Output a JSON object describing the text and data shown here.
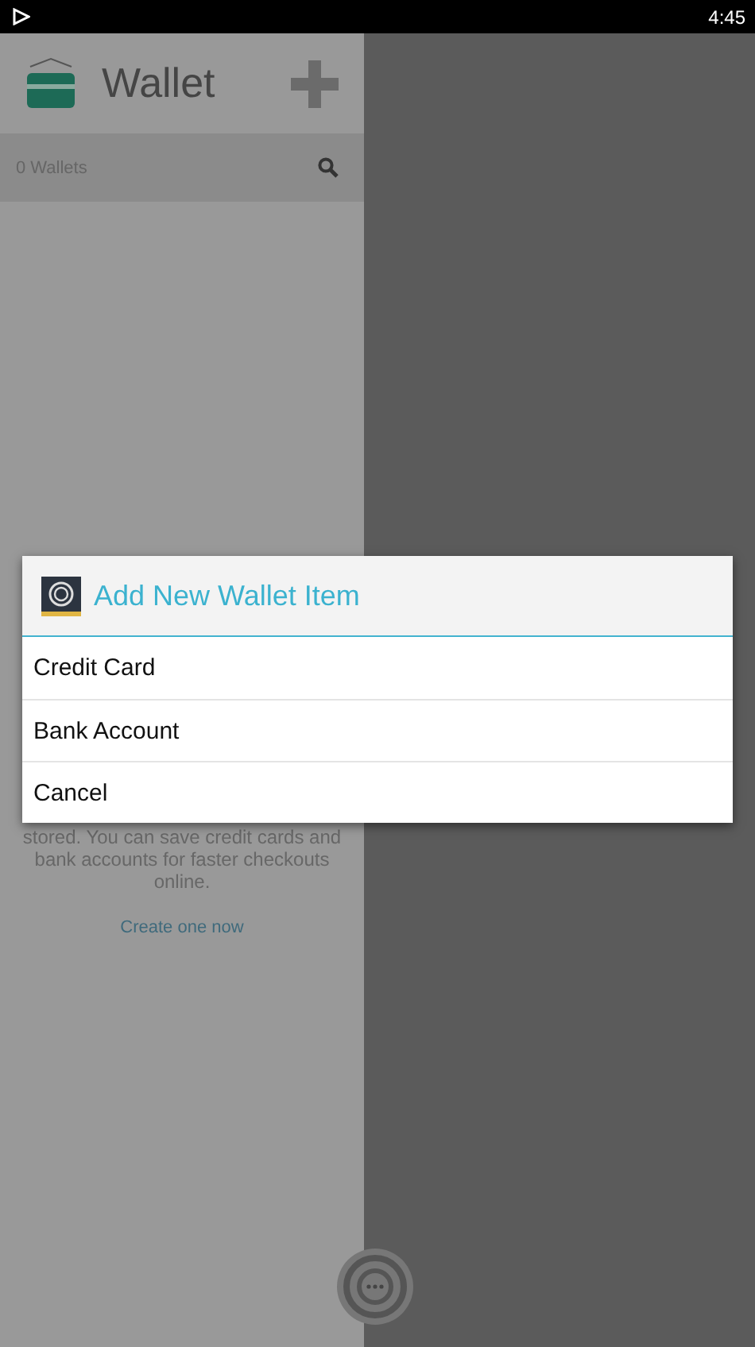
{
  "status_bar": {
    "time": "4:45"
  },
  "header": {
    "title": "Wallet"
  },
  "search_bar": {
    "count": "0 Wallets"
  },
  "empty_state": {
    "message": "stored. You can save credit cards and bank accounts for faster checkouts online.",
    "link": "Create one now"
  },
  "dialog": {
    "title": "Add New Wallet Item",
    "options": [
      "Credit Card",
      "Bank Account",
      "Cancel"
    ]
  }
}
